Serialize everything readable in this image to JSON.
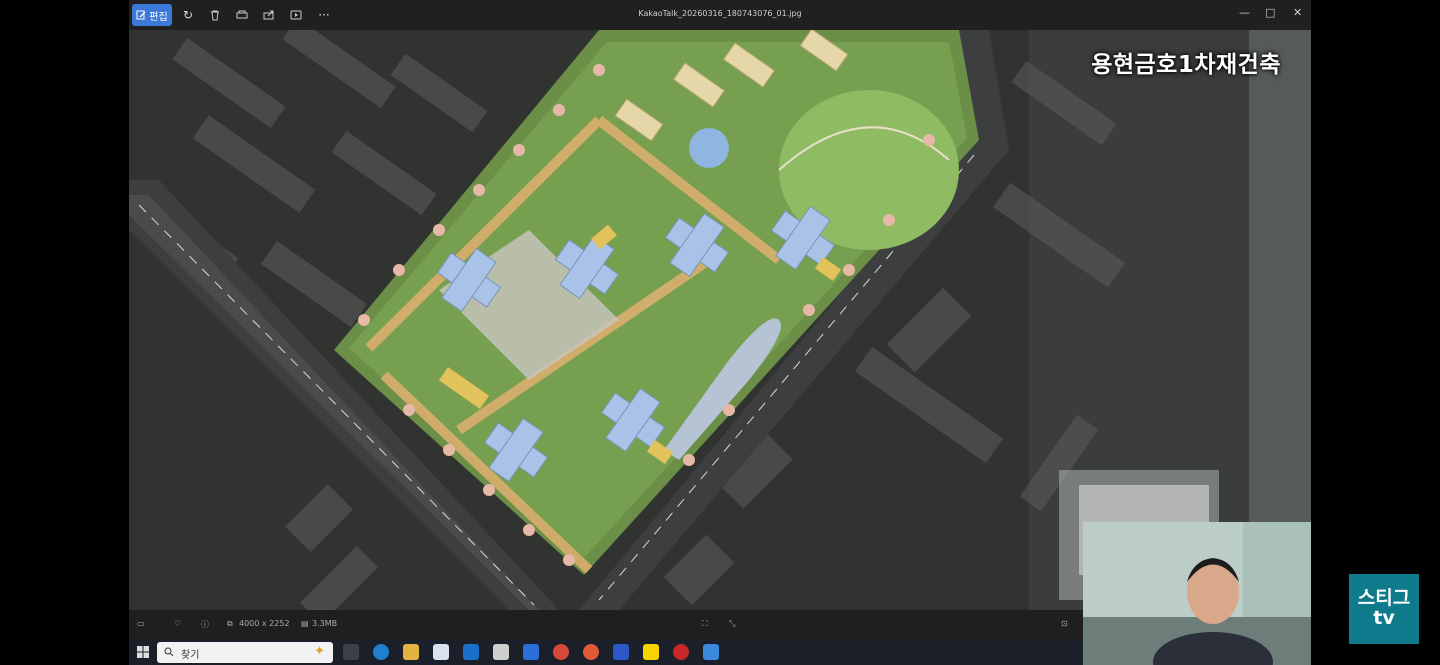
{
  "viewer": {
    "edit_label": "편집",
    "file_name": "KakaoTalk_20260316_180743076_01.jpg"
  },
  "overlay": {
    "title": "용현금호1차재건축"
  },
  "status": {
    "dimensions": "4000 x 2252",
    "file_size": "3.3MB"
  },
  "taskbar": {
    "search_placeholder": "찾기"
  },
  "badge": {
    "line1": "스티그",
    "line2": "tv"
  },
  "colors": {
    "toolbar_bg": "#202020",
    "accent": "#3b78d8",
    "badge_bg": "#0f7a8c",
    "green_space": "#5f8f3c",
    "building_roof": "#a9c3e8",
    "walkway": "#e0b070"
  },
  "icons": [
    "edit-icon",
    "rotate-icon",
    "delete-icon",
    "print-icon",
    "share-icon",
    "slideshow-icon",
    "more-icon",
    "minimize-icon",
    "maximize-icon",
    "close-icon",
    "filmstrip-icon",
    "favorite-icon",
    "info-icon",
    "dimensions-icon",
    "file-size-icon",
    "fit-icon",
    "fullscreen-icon",
    "zoom-out-icon",
    "windows-start-icon",
    "search-icon"
  ]
}
